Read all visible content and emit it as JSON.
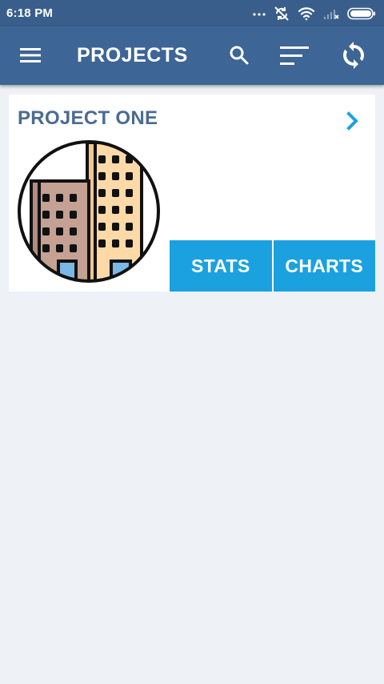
{
  "status_bar": {
    "time": "6:18 PM",
    "icons": [
      "more-dots-icon",
      "sync-off-icon",
      "wifi-icon",
      "signal-off-icon",
      "battery-icon"
    ]
  },
  "app_bar": {
    "title": "PROJECTS",
    "icons": [
      "menu-icon",
      "search-icon",
      "sort-icon",
      "sync-icon"
    ]
  },
  "projects": [
    {
      "name": "PROJECT ONE",
      "image_icon": "buildings-icon",
      "actions": {
        "stats": "STATS",
        "charts": "CHARTS"
      }
    }
  ],
  "colors": {
    "status_bar": "#3a5e8c",
    "app_bar": "#3d6595",
    "background": "#eef2f6",
    "card": "#ffffff",
    "title_text": "#4a6b92",
    "accent": "#1ba1df"
  }
}
